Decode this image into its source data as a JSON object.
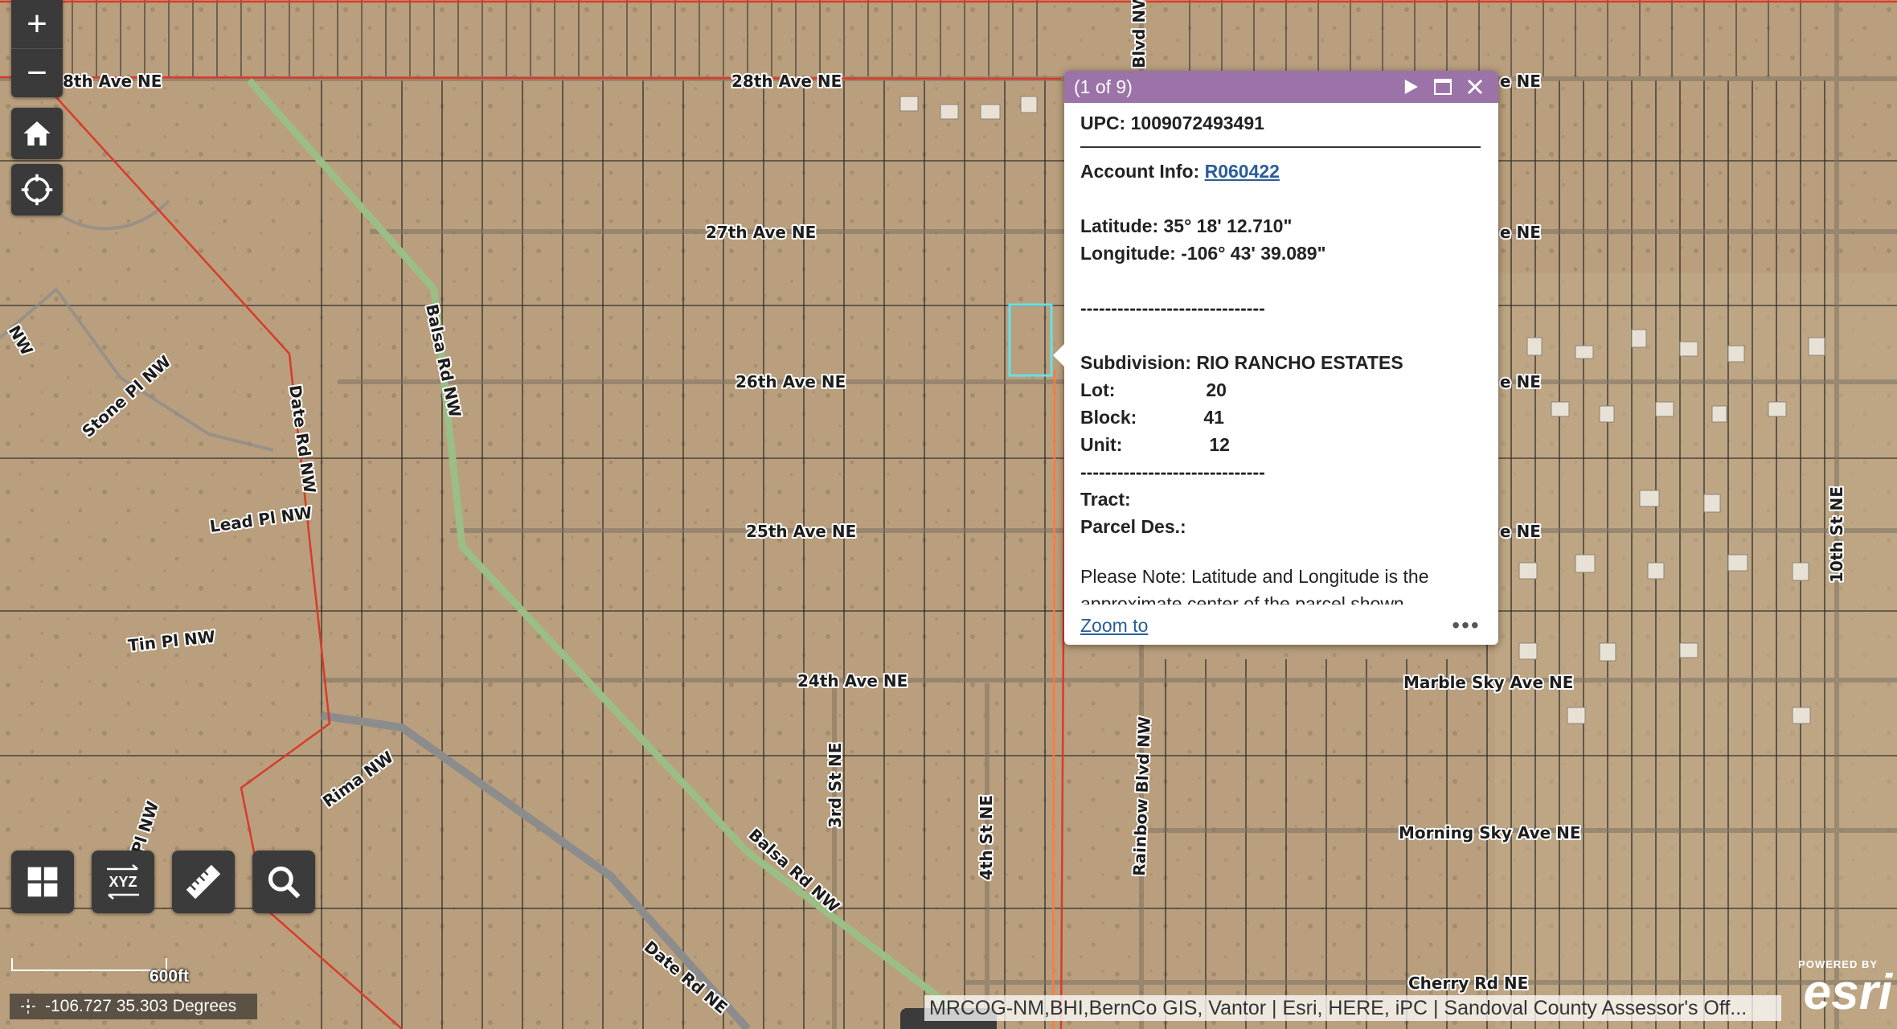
{
  "roads": {
    "ave_28": "28th Ave NE",
    "ave_28_left": "8th Ave NE",
    "ave_27": "27th Ave NE",
    "ave_26": "26th Ave NE",
    "ave_25": "25th Ave NE",
    "ave_24": "24th Ave NE",
    "marble_sky": "Marble Sky Ave NE",
    "morning_sky": "Morning Sky Ave NE",
    "cherry": "Cherry Rd NE",
    "balsa_nw": "Balsa Rd NW",
    "balsa_nw_low": "Balsa Rd NW",
    "date_rd_nw": "Date Rd NW",
    "date_rd_ne": "Date Rd NE",
    "stone": "Stone Pl NW",
    "lead": "Lead Pl NW",
    "tin": "Tin Pl NW",
    "rima": "Rima NW",
    "gym": "m Pl NW",
    "third": "3rd St NE",
    "fourth": "4th St NE",
    "rainbow": "Rainbow Blvd NW",
    "rainbow_top": "Blvd NW",
    "tenth": "10th St NE",
    "ne_suffix": "e NE",
    "nw_edge": "NW"
  },
  "controls": {
    "zoom_in": "+",
    "zoom_out": "−"
  },
  "popup": {
    "pager": "(1 of 9)",
    "upc_label": "UPC:",
    "upc_value": "1009072493491",
    "account_label": "Account Info:",
    "account_value": "R060422",
    "latitude_label": "Latitude:",
    "latitude_value": "35° 18' 12.710\"",
    "longitude_label": "Longitude:",
    "longitude_value": "-106° 43' 39.089\"",
    "divider": "------------------------------",
    "subdivision_label": "Subdivision:",
    "subdivision_value": "RIO RANCHO ESTATES",
    "lot_label": "Lot:",
    "lot_value": "20",
    "block_label": "Block:",
    "block_value": "41",
    "unit_label": "Unit:",
    "unit_value": "12",
    "tract_label": "Tract:",
    "parcel_label": "Parcel Des.:",
    "note": "Please Note: Latitude and Longitude is the",
    "note_cont": "approximate center of the parcel shown",
    "zoom_to": "Zoom to"
  },
  "scale": {
    "label": "600ft"
  },
  "coords": {
    "text": "-106.727 35.303 Degrees"
  },
  "attribution": "MRCOG-NM,BHI,BernCo GIS, Vantor | Esri, HERE, iPC | Sandoval County Assessor's Off...",
  "esri": {
    "powered": "POWERED BY",
    "word": "esri"
  },
  "tools": {
    "xyz": "XYZ"
  },
  "colors": {
    "header": "#9b73a8",
    "boundary": "#d93a2b",
    "road_green": "#9bbd86",
    "highlight": "#66e0e6"
  }
}
